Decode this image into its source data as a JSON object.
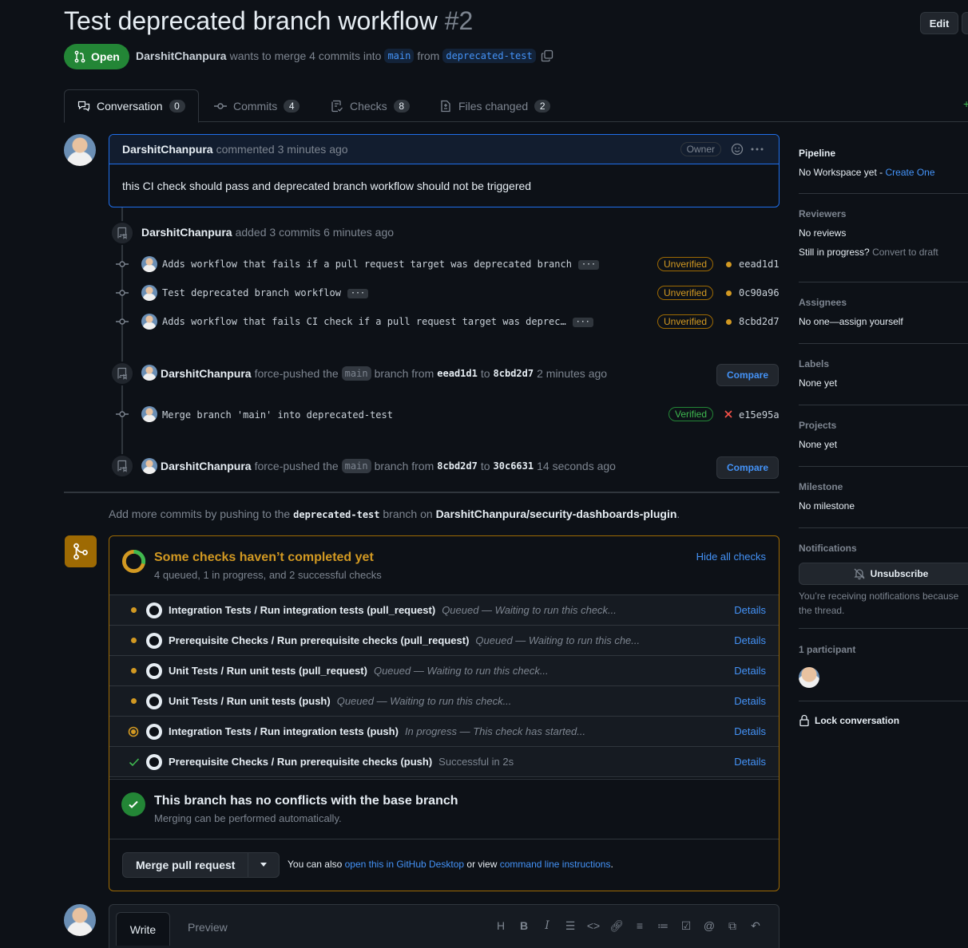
{
  "pr": {
    "title": "Test deprecated branch workflow",
    "number": "#2",
    "edit_label": "Edit",
    "state": "Open",
    "author": "DarshitChanpura",
    "merge_text": "wants to merge 4 commits into",
    "base_branch": "main",
    "from_text": "from",
    "head_branch": "deprecated-test"
  },
  "tabs": [
    {
      "label": "Conversation",
      "count": "0"
    },
    {
      "label": "Commits",
      "count": "4"
    },
    {
      "label": "Checks",
      "count": "8"
    },
    {
      "label": "Files changed",
      "count": "2"
    }
  ],
  "comment": {
    "author": "DarshitChanpura",
    "meta": "commented 3 minutes ago",
    "badge": "Owner",
    "body": "this CI check should pass and deprecated branch workflow should not be triggered"
  },
  "timeline": {
    "added_author": "DarshitChanpura",
    "added_text": "added 3 commits 6 minutes ago",
    "commits": [
      {
        "message": "Adds workflow that fails if a pull request target was deprecated branch",
        "status": "Unverified",
        "sha": "eead1d1"
      },
      {
        "message": "Test deprecated branch workflow",
        "status": "Unverified",
        "sha": "0c90a96"
      },
      {
        "message": "Adds workflow that fails CI check if a pull request target was deprec…",
        "status": "Unverified",
        "sha": "8cbd2d7"
      }
    ],
    "push1": {
      "author": "DarshitChanpura",
      "text1": "force-pushed the",
      "branch": "main",
      "text2": "branch from",
      "from": "eead1d1",
      "to_text": "to",
      "to": "8cbd2d7",
      "time": "2 minutes ago",
      "button": "Compare"
    },
    "merge_commit": {
      "message": "Merge branch 'main' into deprecated-test",
      "status": "Verified",
      "sha": "e15e95a"
    },
    "push2": {
      "author": "DarshitChanpura",
      "text1": "force-pushed the",
      "branch": "main",
      "text2": "branch from",
      "from": "8cbd2d7",
      "to_text": "to",
      "to": "30c6631",
      "time": "14 seconds ago",
      "button": "Compare"
    }
  },
  "push_hint": {
    "prefix": "Add more commits by pushing to the",
    "branch": "deprecated-test",
    "middle": "branch on",
    "repo": "DarshitChanpura/security-dashboards-plugin",
    "suffix": "."
  },
  "checks": {
    "title": "Some checks haven’t completed yet",
    "summary": "4 queued, 1 in progress, and 2 successful checks",
    "hide_label": "Hide all checks",
    "details_label": "Details",
    "rows": [
      {
        "name": "Integration Tests / Run integration tests (pull_request)",
        "desc": "Queued — Waiting to run this check...",
        "state": "queued"
      },
      {
        "name": "Prerequisite Checks / Run prerequisite checks (pull_request)",
        "desc": "Queued — Waiting to run this che...",
        "state": "queued"
      },
      {
        "name": "Unit Tests / Run unit tests (pull_request)",
        "desc": "Queued — Waiting to run this check...",
        "state": "queued"
      },
      {
        "name": "Unit Tests / Run unit tests (push)",
        "desc": "Queued — Waiting to run this check...",
        "state": "queued"
      },
      {
        "name": "Integration Tests / Run integration tests (push)",
        "desc": "In progress — This check has started...",
        "state": "in_progress"
      },
      {
        "name": "Prerequisite Checks / Run prerequisite checks (push)",
        "desc": "Successful in 2s",
        "state": "success"
      }
    ]
  },
  "conflicts": {
    "title": "This branch has no conflicts with the base branch",
    "subtitle": "Merging can be performed automatically."
  },
  "merge": {
    "button": "Merge pull request",
    "also_prefix": "You can also",
    "desktop_link": "open this in GitHub Desktop",
    "or_view": "or view",
    "cli_link": "command line instructions",
    "suffix": "."
  },
  "editor": {
    "write_tab": "Write",
    "preview_tab": "Preview"
  },
  "sidebar": {
    "pipeline": {
      "title": "Pipeline",
      "value": "No Workspace yet - ",
      "link": "Create One"
    },
    "reviewers": {
      "title": "Reviewers",
      "value": "No reviews",
      "draft_q": "Still in progress?",
      "draft_link": "Convert to draft"
    },
    "assignees": {
      "title": "Assignees",
      "value": "No one—",
      "link": "assign yourself"
    },
    "labels": {
      "title": "Labels",
      "value": "None yet"
    },
    "projects": {
      "title": "Projects",
      "value": "None yet"
    },
    "milestone": {
      "title": "Milestone",
      "value": "No milestone"
    },
    "notifications": {
      "title": "Notifications",
      "button": "Unsubscribe",
      "note1": "You’re receiving notifications because",
      "note2": "the thread."
    },
    "participants": {
      "title": "1 participant"
    },
    "lock": "Lock conversation"
  },
  "colors": {
    "accent": "#4493f8",
    "open_green": "#238636",
    "pending": "#d29922",
    "success": "#3fb950",
    "fail": "#f85149"
  }
}
